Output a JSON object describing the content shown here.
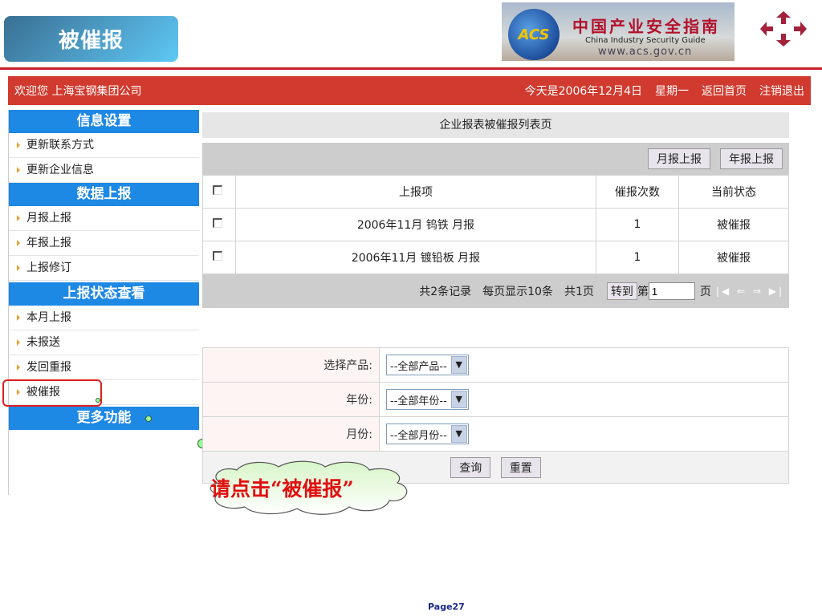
{
  "slide_title": "被催报",
  "banner": {
    "logo_text": "ACS",
    "cn": "中国产业安全指南",
    "en": "China  Industry  Security  Guide",
    "url": "www.acs.gov.cn"
  },
  "topbar": {
    "welcome": "欢迎您  上海宝钢集团公司",
    "date": "今天是2006年12月4日",
    "weekday": "星期一",
    "home": "返回首页",
    "logout": "注销退出"
  },
  "sidebar": {
    "sections": [
      {
        "title": "信息设置",
        "items": [
          "更新联系方式",
          "更新企业信息"
        ]
      },
      {
        "title": "数据上报",
        "items": [
          "月报上报",
          "年报上报",
          "上报修订"
        ]
      },
      {
        "title": "上报状态查看",
        "items": [
          "本月上报",
          "未报送",
          "发回重报",
          "被催报"
        ]
      },
      {
        "title": "更多功能",
        "items": []
      }
    ]
  },
  "main": {
    "title": "企业报表被催报列表页",
    "toolbar": {
      "monthly": "月报上报",
      "yearly": "年报上报"
    },
    "columns": [
      "上报项",
      "催报次数",
      "当前状态"
    ],
    "rows": [
      {
        "item": "2006年11月  钨铁  月报",
        "count": "1",
        "status": "被催报"
      },
      {
        "item": "2006年11月  镀铅板  月报",
        "count": "1",
        "status": "被催报"
      }
    ],
    "pager": {
      "total": "共2条记录",
      "per_page": "每页显示10条",
      "pages": "共1页",
      "goto": "转到",
      "prefix": "第",
      "page_value": "1",
      "suffix": "页",
      "nav": "|◀ ⇐ ⇒ ▶|"
    }
  },
  "filter": {
    "product_label": "选择产品:",
    "product_value": "--全部产品--",
    "year_label": "年份:",
    "year_value": "--全部年份--",
    "month_label": "月份:",
    "month_value": "--全部月份--",
    "query": "查询",
    "reset": "重置"
  },
  "callout": "请点击“被催报”",
  "page_number": "Page27"
}
